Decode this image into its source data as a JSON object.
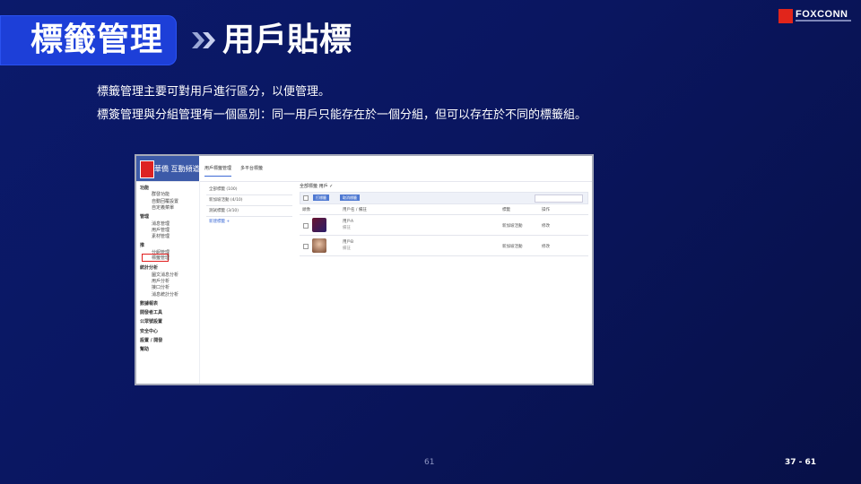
{
  "header": {
    "title": "標籤管理",
    "subtitle": "用戶貼標",
    "logo_text": "FOXCONN"
  },
  "description": [
    "標籤管理主要可對用戶進行區分，以便管理。",
    "標簽管理與分組管理有一個區別：同一用戶只能存在於一個分組，但可以存在於不同的標籤組。"
  ],
  "screenshot": {
    "brand": "華僑 互動頻道",
    "tabs": [
      "用戶標籤管理",
      "多平台標籤"
    ],
    "sidebar": [
      {
        "label": "功能",
        "group": true
      },
      {
        "label": "群發功能",
        "group": false
      },
      {
        "label": "自動回覆設置",
        "group": false
      },
      {
        "label": "自定義菜單",
        "group": false
      },
      {
        "label": "管理",
        "group": true
      },
      {
        "label": "消息管理",
        "group": false
      },
      {
        "label": "用戶管理",
        "group": false
      },
      {
        "label": "素材管理",
        "group": false
      },
      {
        "label": "推",
        "group": true
      },
      {
        "label": "分組管理",
        "group": false
      },
      {
        "label": "標籤管理",
        "group": false
      },
      {
        "label": "統計分析",
        "group": true
      },
      {
        "label": "圖文消息分析",
        "group": false
      },
      {
        "label": "用戶分析",
        "group": false
      },
      {
        "label": "接口分析",
        "group": false
      },
      {
        "label": "消息統計分析",
        "group": false
      },
      {
        "label": "數據報表",
        "group": true
      },
      {
        "label": "開發者工具",
        "group": true
      },
      {
        "label": "公眾號設置",
        "group": true
      },
      {
        "label": "安全中心",
        "group": true
      },
      {
        "label": "設置 / 開發",
        "group": true
      },
      {
        "label": "幫助",
        "group": true
      }
    ],
    "label_groups": [
      "全部標籤 (100)",
      "新加坡活動 (4/10)",
      "測試標籤 (3/10)",
      "新建標籤 +"
    ],
    "main_title": "全部標籤 用戶 ✓",
    "buttons": [
      "打標籤",
      "取消標籤"
    ],
    "columns": [
      "頭像",
      "用戶名 / 備註",
      "標籤",
      "操作"
    ],
    "rows": [
      {
        "name": "用戶A",
        "note": "備註",
        "tag": "新加坡活動",
        "action": "修改"
      },
      {
        "name": "用戶B",
        "note": "備註",
        "tag": "新加坡活動",
        "action": "修改"
      }
    ]
  },
  "footer": {
    "page_center": "61",
    "page_right": "37 - 61"
  },
  "colors": {
    "accent": "#1d3fd8",
    "highlight": "#e01d1d",
    "logo_red": "#e1251b"
  }
}
